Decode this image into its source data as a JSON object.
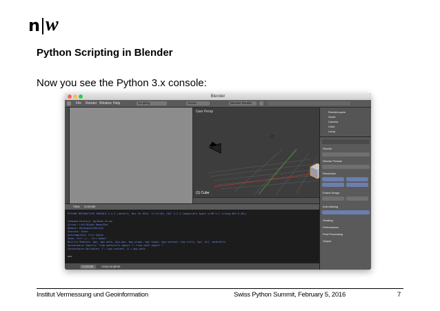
{
  "header": {
    "logo": {
      "left": "n",
      "right": "w"
    },
    "title": "Python Scripting in Blender"
  },
  "content": {
    "text": "Now you see the Python 3.x console:"
  },
  "screenshot": {
    "window_title": "Blender",
    "menus": [
      "File",
      "Render",
      "Window",
      "Help"
    ],
    "screen_field": "Scripting",
    "scene_field": "Scene",
    "engine_field": "Blender Render",
    "viewport_label": "User Persp",
    "object_label": "(1) Cube",
    "console_menus": [
      "View",
      "Console"
    ],
    "console_tabs": [
      "Console",
      "Autocomplete"
    ],
    "console_lines": [
      "PYTHON INTERACTIVE CONSOLE 3.4.2 (default, Nov 25 2014, 17:13:46) [GCC 4.2.1 Compatible Apple LLVM 5.1 (clang-503.0.40)]",
      "",
      "Command History:   Up/Down Arrow",
      "Cursor:            Left/Right Home/End",
      "Remove:            Backspace/Delete",
      "Execute:           Enter",
      "Autocomplete:      Ctrl-Space",
      "Zoom:              Ctrl +/-, Ctrl-Wheel",
      "Builtin Modules:   bpy, bpy.data, bpy.ops, bpy.props, bpy.types, bpy.context, bpy.utils, bgl, blf, mathutils",
      "Convenience Imports: from mathutils import *; from math import *",
      "Convenience Variables: C = bpy.context, D = bpy.data",
      "",
      ">>>"
    ],
    "outliner_items": [
      "RenderLayers",
      "World",
      "Camera",
      "Cube",
      "Lamp"
    ],
    "props_items": [
      "Render",
      "Render Presets",
      "Resolution",
      "Frame Range",
      "Anti-Aliasing",
      "Shading",
      "Performance",
      "Post Processing",
      "Output"
    ],
    "colors": {
      "console_text": "#6f8df6",
      "console_bg": "#1c1c1c",
      "viewport_bg": "#3d3d3d",
      "header_bg": "#5a5a5a"
    }
  },
  "footer": {
    "institute": "Institut Vermessung und Geoinformation",
    "event": "Swiss Python Summit, February 5, 2016",
    "page_number": "7"
  }
}
